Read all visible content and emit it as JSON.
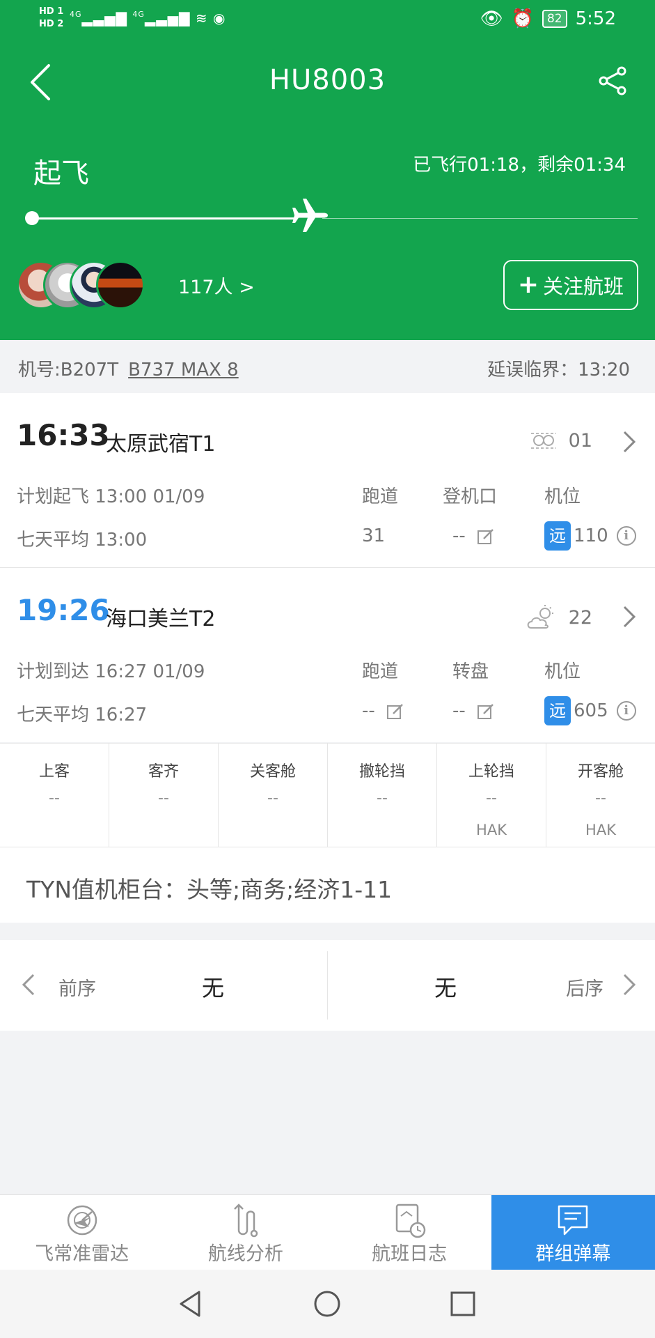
{
  "status_bar": {
    "signal_text_1": "HD 1",
    "signal_text_2": "HD 2",
    "network_1": "4G",
    "network_2": "4G",
    "battery": "82",
    "time": "5:52"
  },
  "header": {
    "flight_no": "HU8003",
    "phase": "起飞",
    "elapsed_text": "已飞行01:18，剩余01:34",
    "progress_fraction": 0.44,
    "followers": "117人 >",
    "follow_button": "关注航班",
    "colors": {
      "bg": "#13a54e",
      "accent": "#2f8ee8"
    }
  },
  "aircraft": {
    "registration": "机号:B207T",
    "model": "B737 MAX 8",
    "delay_threshold": "延误临界：13:20"
  },
  "departure": {
    "time": "16:33",
    "airport": "太原武宿T1",
    "weather_icon": "haze-icon",
    "temperature": "01",
    "scheduled": "计划起飞 13:00 01/09",
    "avg": "七天平均 13:00",
    "col_runway": "跑道",
    "col_gate": "登机口",
    "col_stand": "机位",
    "runway": "31",
    "gate": "--",
    "stand_badge": "远",
    "stand": "110"
  },
  "arrival": {
    "time": "19:26",
    "airport": "海口美兰T2",
    "weather_icon": "partly-cloudy-icon",
    "temperature": "22",
    "scheduled": "计划到达 16:27 01/09",
    "avg": "七天平均 16:27",
    "col_runway": "跑道",
    "col_carousel": "转盘",
    "col_stand": "机位",
    "runway": "--",
    "carousel": "--",
    "stand_badge": "远",
    "stand": "605"
  },
  "nodes": [
    {
      "label": "上客",
      "value": "--",
      "airport": ""
    },
    {
      "label": "客齐",
      "value": "--",
      "airport": ""
    },
    {
      "label": "关客舱",
      "value": "--",
      "airport": ""
    },
    {
      "label": "撤轮挡",
      "value": "--",
      "airport": ""
    },
    {
      "label": "上轮挡",
      "value": "--",
      "airport": "HAK"
    },
    {
      "label": "开客舱",
      "value": "--",
      "airport": "HAK"
    }
  ],
  "counter": "TYN值机柜台：头等;商务;经济1-11",
  "sequence": {
    "prev_label": "前序",
    "prev_value": "无",
    "next_value": "无",
    "next_label": "后序"
  },
  "tabs": [
    {
      "label": "飞常准雷达",
      "icon": "radar-icon"
    },
    {
      "label": "航线分析",
      "icon": "route-icon"
    },
    {
      "label": "航班日志",
      "icon": "log-icon"
    },
    {
      "label": "群组弹幕",
      "icon": "chat-icon"
    }
  ]
}
